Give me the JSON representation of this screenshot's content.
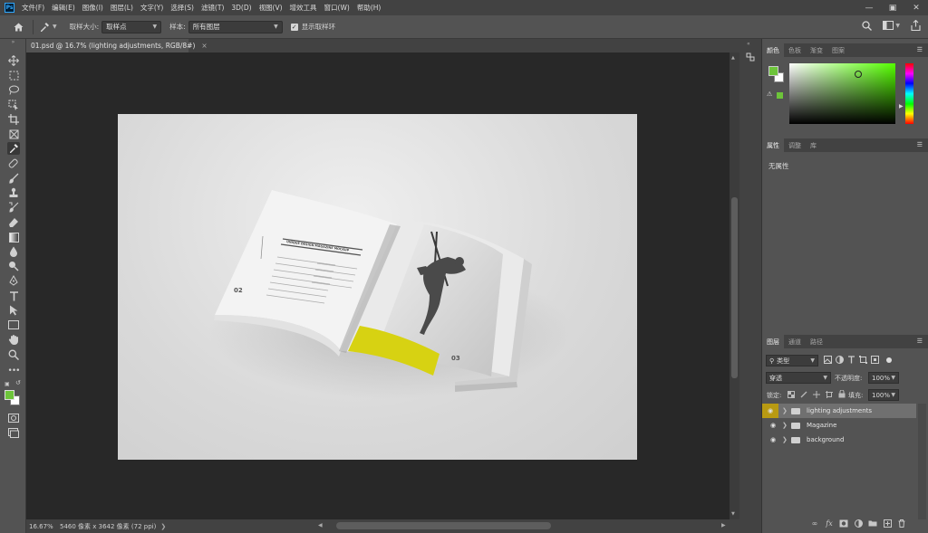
{
  "menubar": {
    "app_icon": "Ps",
    "items": [
      "文件(F)",
      "编辑(E)",
      "图像(I)",
      "图层(L)",
      "文字(Y)",
      "选择(S)",
      "滤镜(T)",
      "3D(D)",
      "视图(V)",
      "增效工具",
      "窗口(W)",
      "帮助(H)"
    ]
  },
  "options": {
    "sample_size_label": "取样大小:",
    "sample_size_value": "取样点",
    "sample_label": "样本:",
    "sample_value": "所有图层",
    "show_ring_label": "显示取样环"
  },
  "document": {
    "tab_title": "01.psd @ 16.7% (lighting adjustments, RGB/8#)",
    "page_left_number": "02",
    "page_right_number": "03",
    "mag_title": "UNIQUE DESIGN MAGAZINE MOCKUP"
  },
  "status": {
    "zoom": "16.67%",
    "dimensions": "5460 像素 x 3642 像素 (72 ppi)"
  },
  "color_panel": {
    "tabs": [
      "颜色",
      "色板",
      "渐变",
      "图案"
    ],
    "foreground": "#6dc43a",
    "background": "#ffffff",
    "hue": "#55ff00"
  },
  "properties_panel": {
    "tabs": [
      "属性",
      "调整",
      "库"
    ],
    "empty_text": "无属性"
  },
  "layers_panel": {
    "tabs": [
      "图层",
      "通道",
      "路径"
    ],
    "filter_kind": "类型",
    "blend_mode": "穿透",
    "opacity_label": "不透明度:",
    "opacity_value": "100%",
    "lock_label": "锁定:",
    "fill_label": "填充:",
    "fill_value": "100%",
    "layers": [
      {
        "name": "lighting adjustments"
      },
      {
        "name": "Magazine"
      },
      {
        "name": "background"
      }
    ],
    "accent_eye": "#b89a12"
  }
}
